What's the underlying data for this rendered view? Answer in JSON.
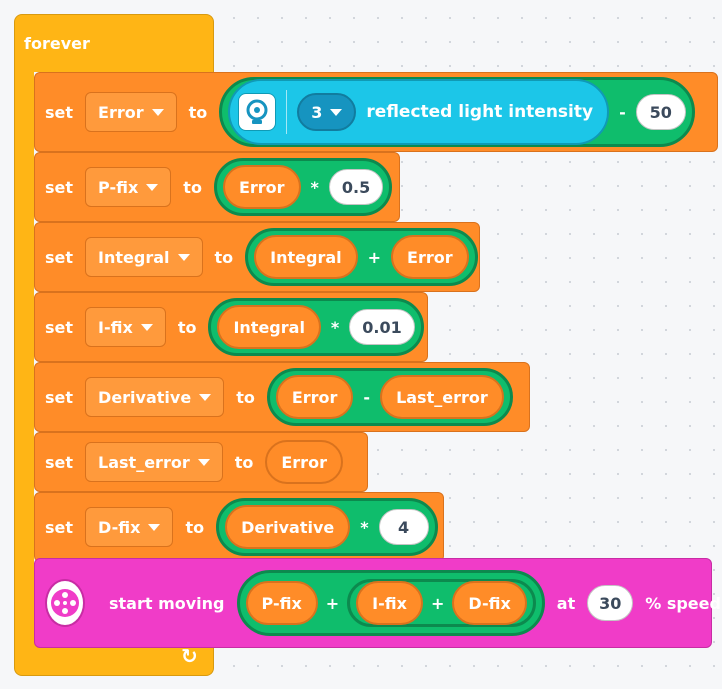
{
  "forever": {
    "label": "forever"
  },
  "icons": {
    "light_sensor": "light-sensor-icon",
    "motor": "motor-pair-icon",
    "loop_arrow": "loop-arrow-icon"
  },
  "colors": {
    "control": "#ffb515",
    "variables": "#ff8c28",
    "operators": "#0fbd6c",
    "sensors": "#1cc6e8",
    "movement": "#f03cc8"
  },
  "blocks": {
    "error": {
      "set": "set",
      "var": "Error",
      "to": "to",
      "port": "3",
      "sensor_text": "reflected light intensity",
      "op": "-",
      "value": "50"
    },
    "pfix": {
      "set": "set",
      "var": "P-fix",
      "to": "to",
      "left": "Error",
      "op": "*",
      "value": "0.5"
    },
    "integral": {
      "set": "set",
      "var": "Integral",
      "to": "to",
      "left": "Integral",
      "op": "+",
      "right": "Error"
    },
    "ifix": {
      "set": "set",
      "var": "I-fix",
      "to": "to",
      "left": "Integral",
      "op": "*",
      "value": "0.01"
    },
    "derivative": {
      "set": "set",
      "var": "Derivative",
      "to": "to",
      "left": "Error",
      "op": "-",
      "right": "Last_error"
    },
    "last_error": {
      "set": "set",
      "var": "Last_error",
      "to": "to",
      "value_var": "Error"
    },
    "dfix": {
      "set": "set",
      "var": "D-fix",
      "to": "to",
      "left": "Derivative",
      "op": "*",
      "value": "4"
    }
  },
  "motor": {
    "label": "start moving",
    "a": "P-fix",
    "op1": "+",
    "b": "I-fix",
    "op2": "+",
    "c": "D-fix",
    "at": "at",
    "speed": "30",
    "suffix": "% speed"
  }
}
